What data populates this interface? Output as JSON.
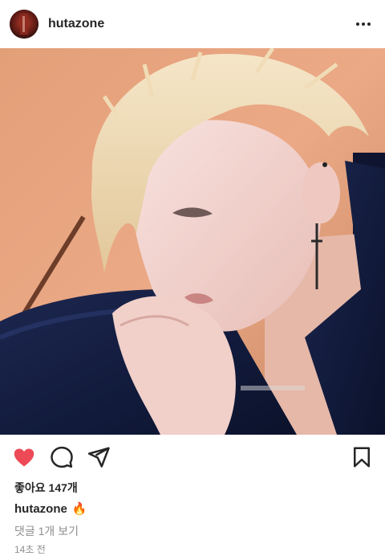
{
  "header": {
    "username": "hutazone",
    "avatar_icon": "profile-avatar",
    "more_icon": "more-dots-icon"
  },
  "post": {
    "image_description_icon": "post-photo",
    "actions": {
      "like_icon": "heart-icon",
      "like_state": "liked",
      "like_color": "#ed4956",
      "comment_icon": "comment-icon",
      "share_icon": "share-icon",
      "save_icon": "bookmark-icon"
    },
    "likes_text": "좋아요 147개",
    "caption": {
      "username": "hutazone",
      "emoji": "🔥"
    },
    "view_comments_text": "댓글 1개 보기",
    "timestamp_text": "14초 전"
  }
}
